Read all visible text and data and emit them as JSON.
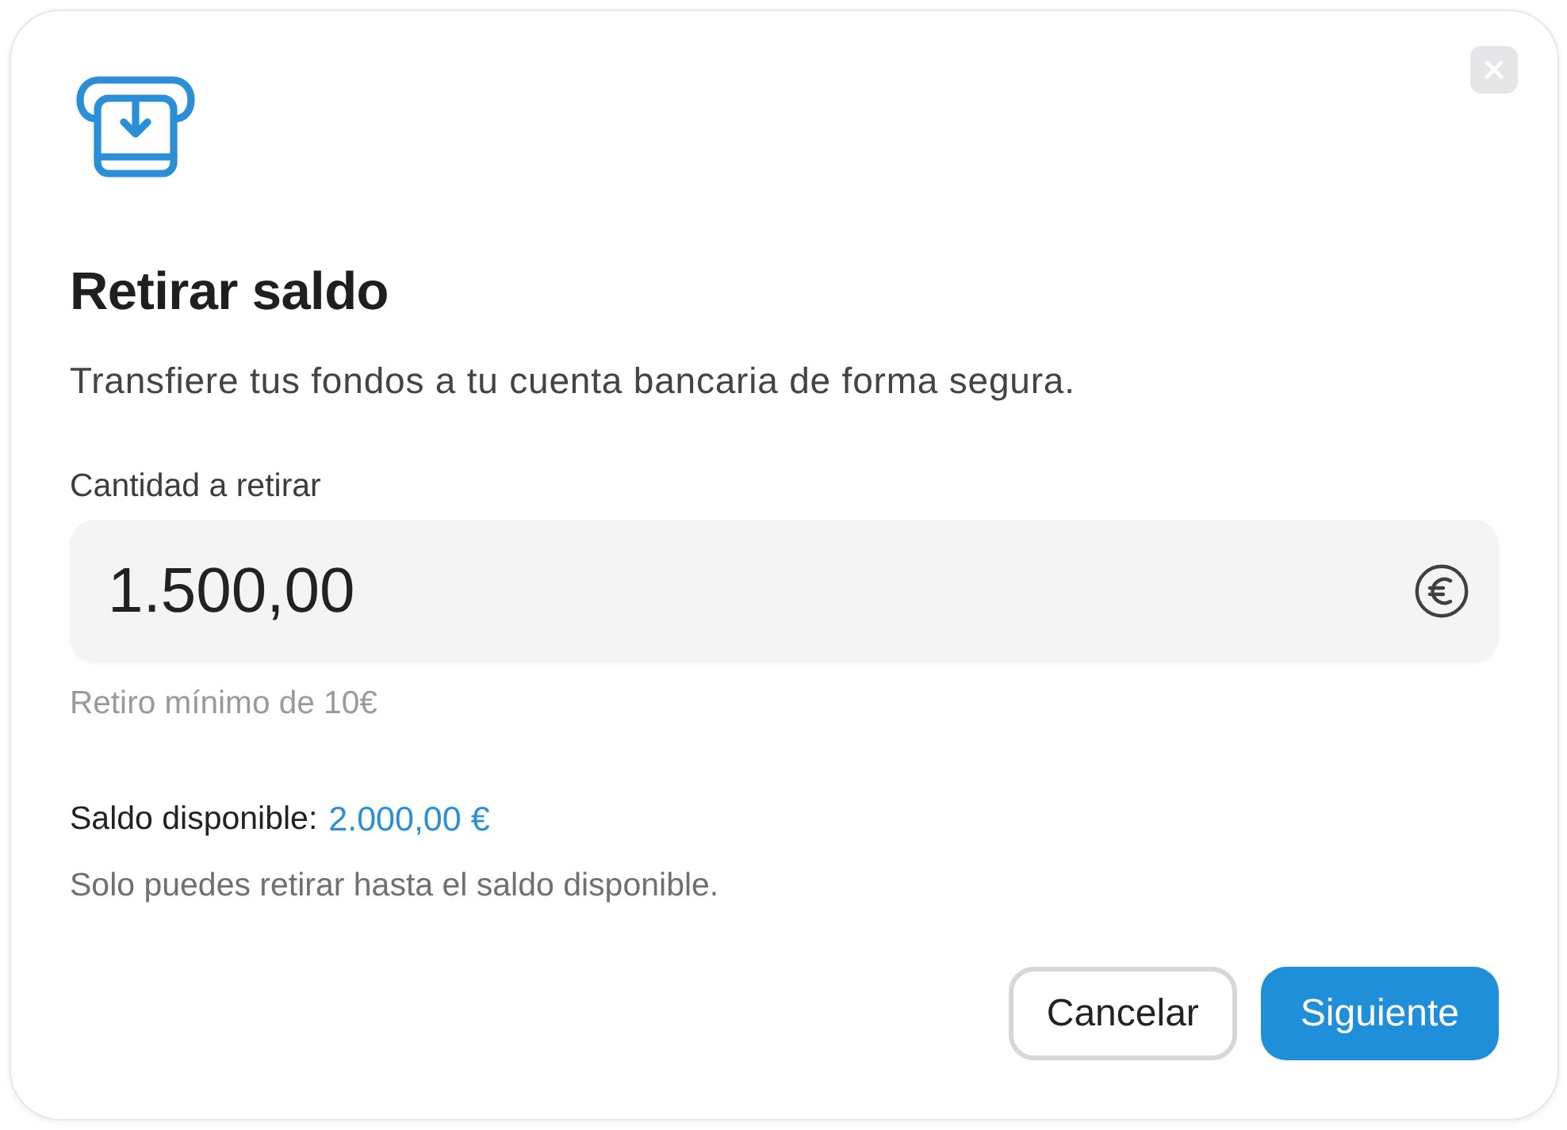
{
  "dialog": {
    "title": "Retirar saldo",
    "subtitle": "Transfiere tus fondos a tu cuenta bancaria de forma segura.",
    "amount_field": {
      "label": "Cantidad a retirar",
      "value": "1.500,00",
      "hint": "Retiro mínimo de 10€"
    },
    "balance": {
      "label": "Saldo disponible:",
      "value": "2.000,00 €"
    },
    "note": "Solo puedes retirar hasta el saldo disponible.",
    "buttons": [
      {
        "label": "Cancelar",
        "kind": "secondary"
      },
      {
        "label": "Siguiente",
        "kind": "primary"
      }
    ]
  }
}
